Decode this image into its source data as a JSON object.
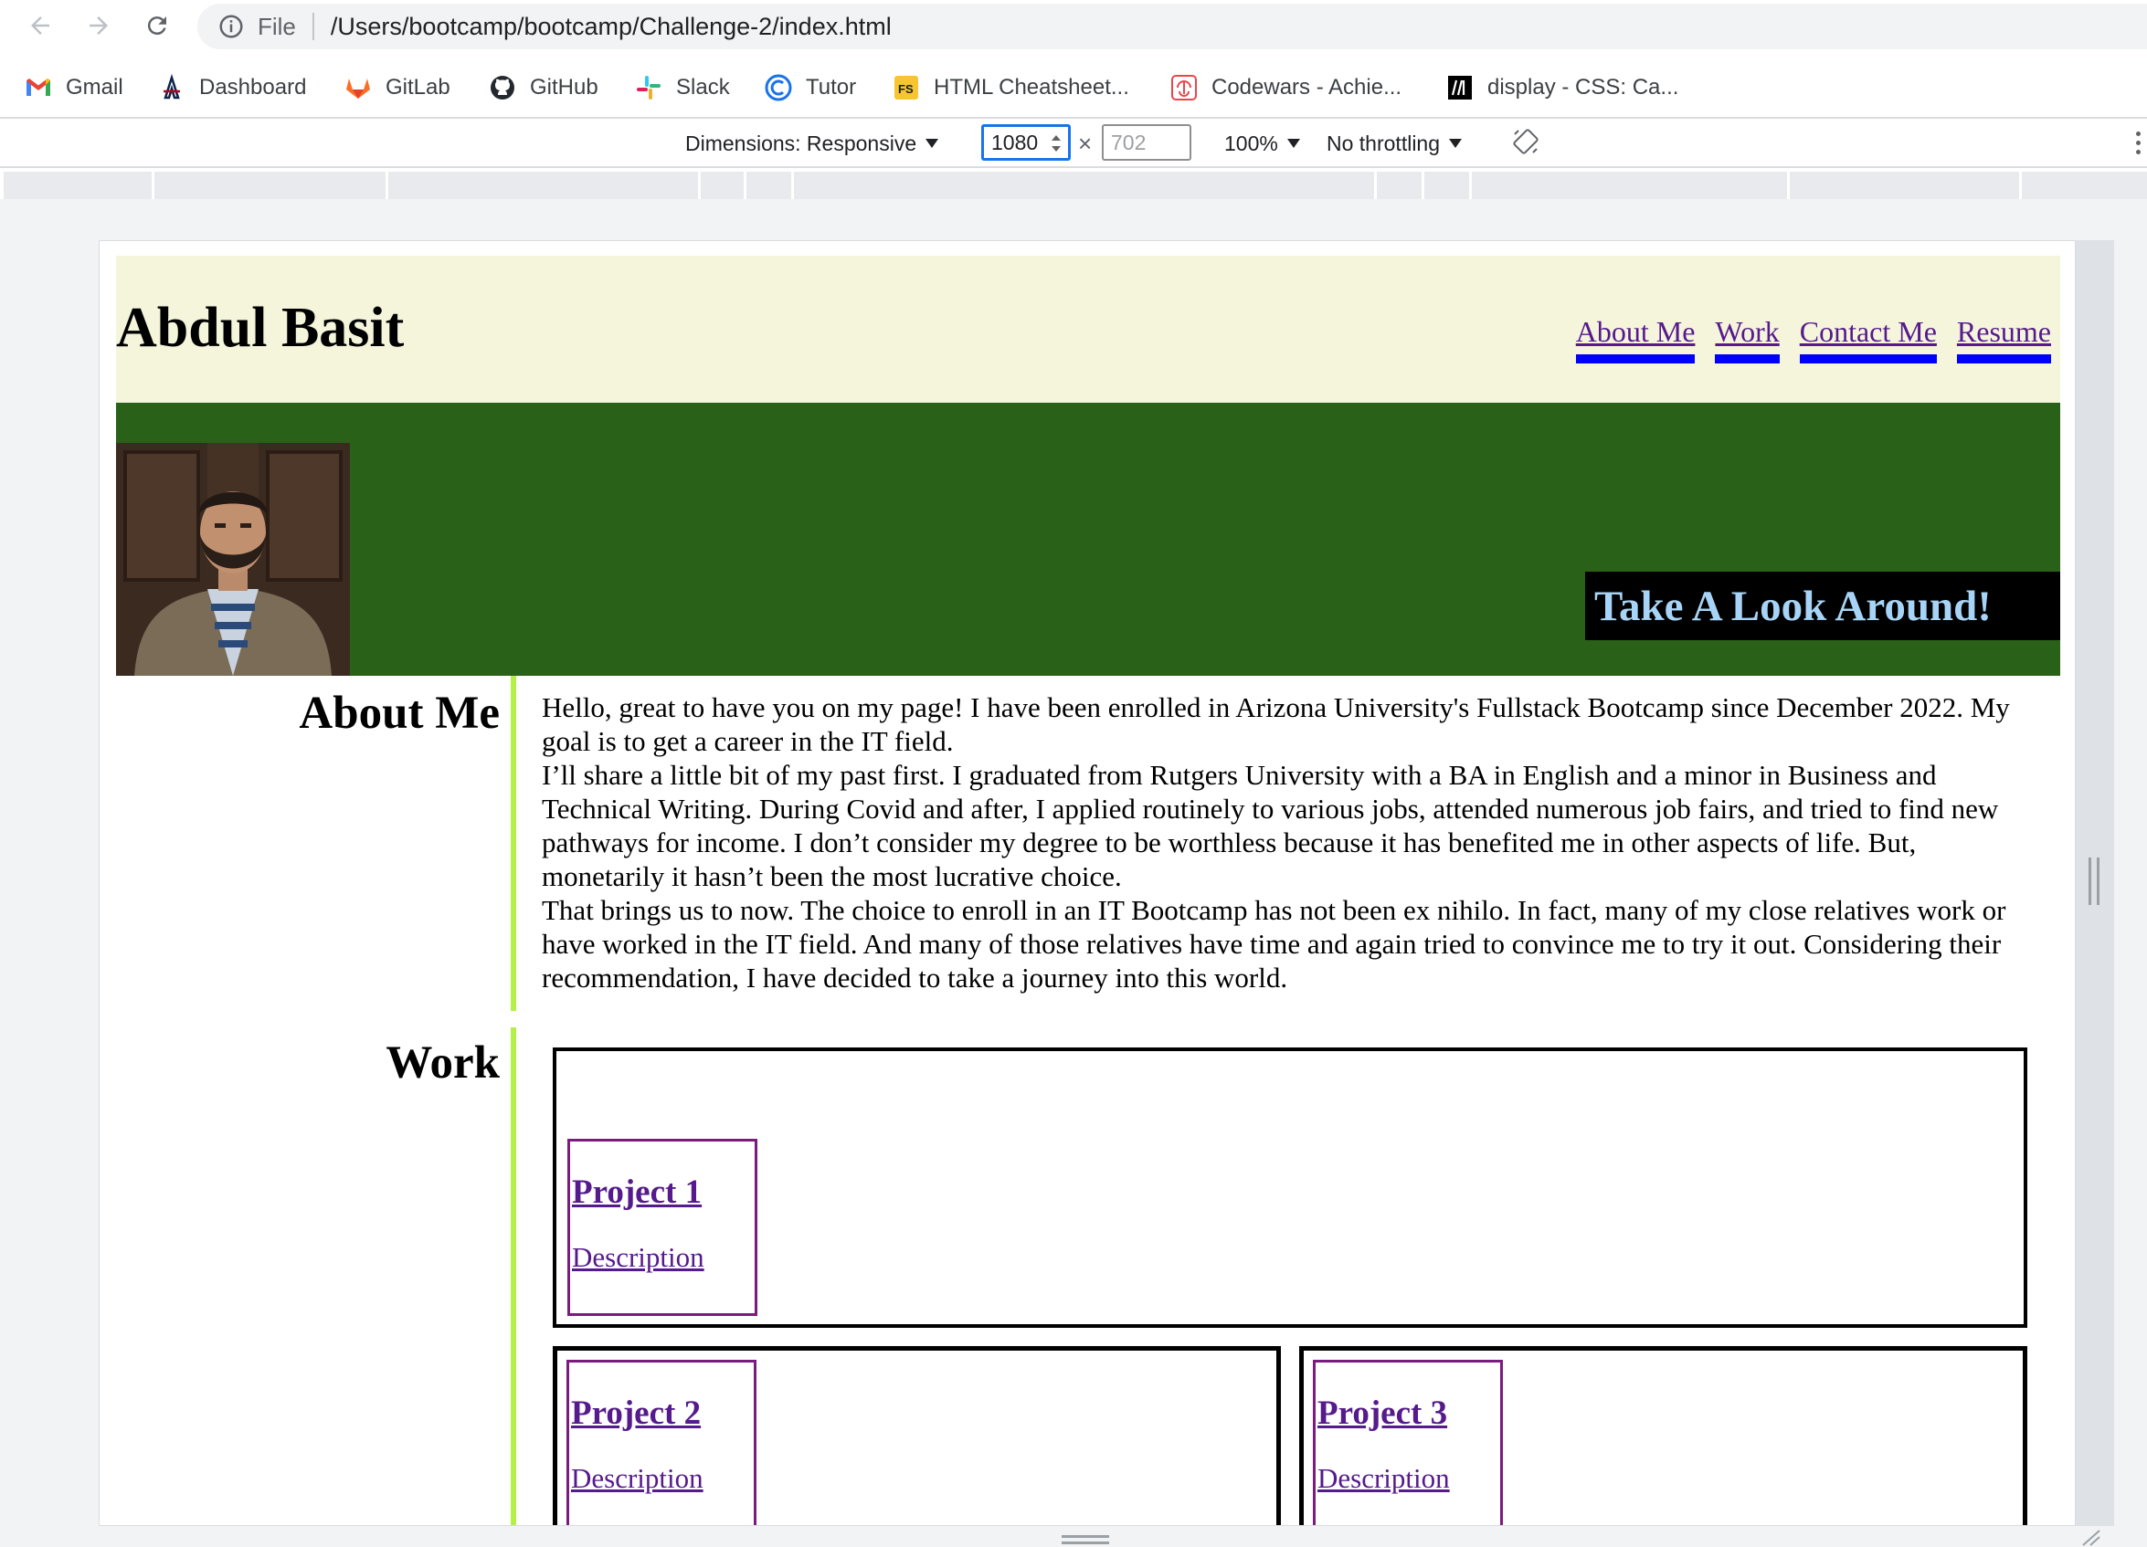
{
  "browser": {
    "scheme": "File",
    "url": "/Users/bootcamp/bootcamp/Challenge-2/index.html"
  },
  "bookmarks": [
    {
      "label": "Gmail",
      "icon": "gmail-icon"
    },
    {
      "label": "Dashboard",
      "icon": "arizona-logo-icon"
    },
    {
      "label": "GitLab",
      "icon": "gitlab-icon"
    },
    {
      "label": "GitHub",
      "icon": "github-icon"
    },
    {
      "label": "Slack",
      "icon": "slack-icon"
    },
    {
      "label": "Tutor",
      "icon": "tutor-icon"
    },
    {
      "label": "HTML Cheatsheet...",
      "icon": "fs-icon"
    },
    {
      "label": "Codewars - Achie...",
      "icon": "codewars-icon"
    },
    {
      "label": "display - CSS: Ca...",
      "icon": "mdn-icon"
    }
  ],
  "devtools": {
    "dimensions_label": "Dimensions: Responsive",
    "width_value": "1080",
    "height_placeholder": "702",
    "times": "×",
    "zoom": "100%",
    "throttling": "No throttling"
  },
  "site": {
    "title": "Abdul Basit",
    "nav": [
      "About Me",
      "Work",
      "Contact Me",
      "Resume"
    ],
    "cta": "Take A Look Around!",
    "about": {
      "heading": "About Me",
      "paragraphs": [
        "Hello, great to have you on my page! I have been enrolled in Arizona University's Fullstack Bootcamp since December 2022. My goal is to get a career in the IT field.",
        "I’ll share a little bit of my past first. I graduated from Rutgers University with a BA in English and a minor in Business and Technical Writing. During Covid and after, I applied routinely to various jobs, attended numerous job fairs, and tried to find new pathways for income. I don’t consider my degree to be worthless because it has benefited me in other aspects of life. But, monetarily it hasn’t been the most lucrative choice.",
        "That brings us to now. The choice to enroll in an IT Bootcamp has not been ex nihilo. In fact, many of my close relatives work or have worked in the IT field. And many of those relatives have time and again tried to convince me to try it out. Considering their recommendation, I have decided to take a journey into this world."
      ]
    },
    "work": {
      "heading": "Work",
      "projects": [
        {
          "title": "Project 1",
          "description": "Description"
        },
        {
          "title": "Project 2",
          "description": "Description"
        },
        {
          "title": "Project 3",
          "description": "Description"
        }
      ]
    }
  },
  "colors": {
    "header_bg": "#f5f5dc",
    "hero_bg": "#2a6118",
    "nav_underline": "#0000ff",
    "section_bar": "#b4f048",
    "cta_text": "#a7d4f6",
    "project_border": "#7b1b7e"
  }
}
